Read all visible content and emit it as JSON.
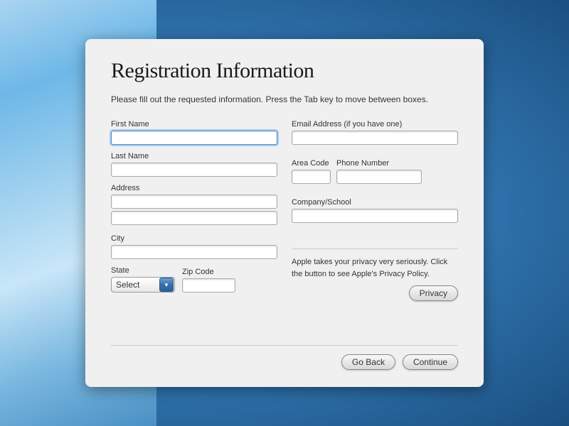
{
  "background": {
    "color": "#4a90c4"
  },
  "panel": {
    "title": "Registration Information",
    "subtitle": "Please fill out the requested information. Press the Tab key to move between boxes.",
    "left_col": {
      "first_name": {
        "label": "First Name",
        "placeholder": "",
        "value": ""
      },
      "last_name": {
        "label": "Last Name",
        "placeholder": "",
        "value": ""
      },
      "address": {
        "label": "Address",
        "line1_value": "",
        "line2_value": ""
      },
      "city": {
        "label": "City",
        "value": ""
      },
      "state": {
        "label": "State",
        "select_default": "Select"
      },
      "zip": {
        "label": "Zip Code",
        "value": ""
      }
    },
    "right_col": {
      "email": {
        "label": "Email Address (if you have one)",
        "value": ""
      },
      "area_code": {
        "label": "Area Code",
        "value": ""
      },
      "phone": {
        "label": "Phone Number",
        "value": ""
      },
      "company": {
        "label": "Company/School",
        "value": ""
      },
      "privacy_text": "Apple takes your privacy very seriously. Click the button to see Apple's Privacy Policy.",
      "privacy_button": "Privacy"
    },
    "footer": {
      "go_back": "Go Back",
      "continue": "Continue"
    }
  }
}
